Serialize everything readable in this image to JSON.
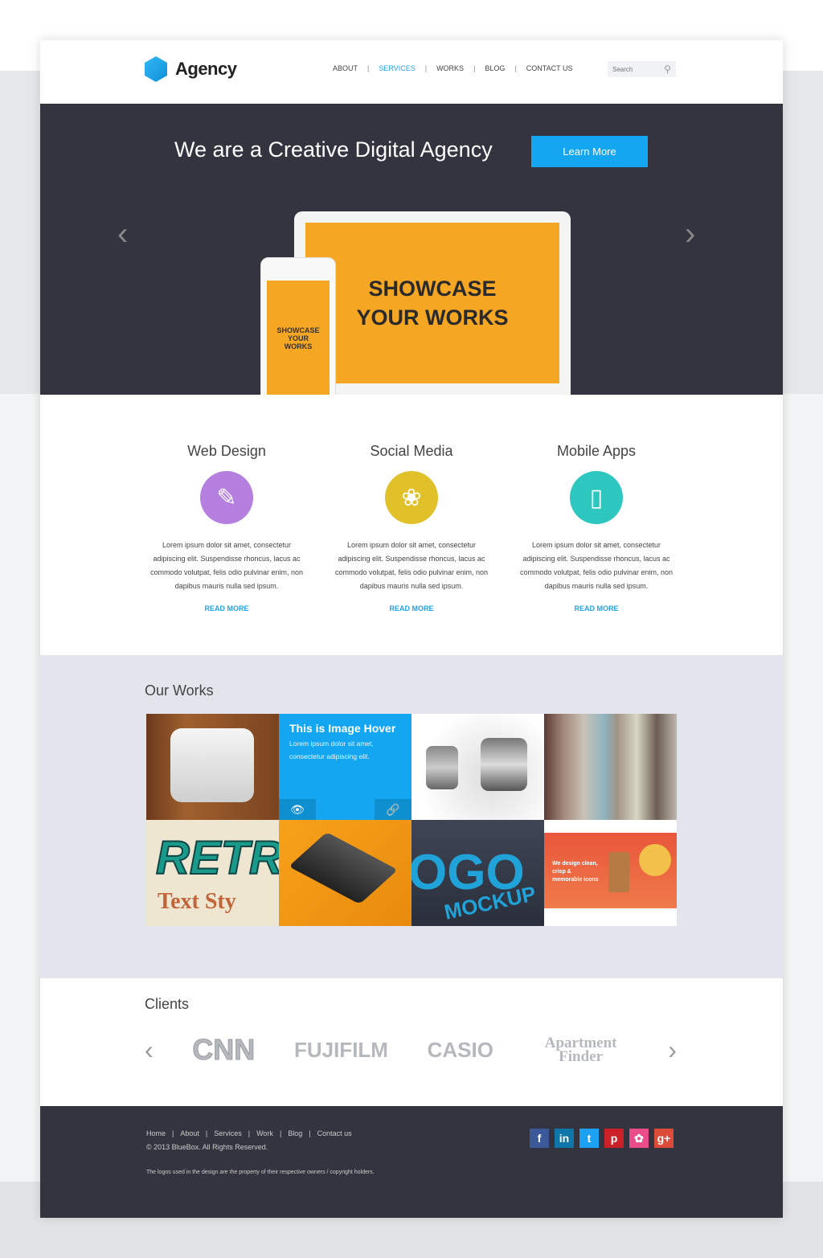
{
  "header": {
    "logo": "Agency",
    "nav": [
      "ABOUT",
      "SERVICES",
      "WORKS",
      "BLOG",
      "CONTACT US"
    ],
    "active_nav": "SERVICES",
    "search_placeholder": "Search"
  },
  "hero": {
    "title": "We are a Creative Digital Agency",
    "button": "Learn More",
    "laptop_text": "SHOWCASE YOUR WORKS",
    "phone_text": "SHOWCASE YOUR WORKS"
  },
  "services": [
    {
      "title": "Web Design",
      "icon": "paintbrush-icon",
      "color": "#b57fe0",
      "text": "Lorem ipsum dolor sit amet, consectetur adipiscing elit. Suspendisse rhoncus, lacus ac commodo volutpat, felis odio pulvinar enim, non dapibus mauris nulla sed ipsum.",
      "link": "READ MORE"
    },
    {
      "title": "Social Media",
      "icon": "share-icon",
      "color": "#e0c12a",
      "text": "Lorem ipsum dolor sit amet, consectetur adipiscing elit. Suspendisse rhoncus, lacus ac commodo volutpat, felis odio pulvinar enim, non dapibus mauris nulla sed ipsum.",
      "link": "READ MORE"
    },
    {
      "title": "Mobile Apps",
      "icon": "smartphone-icon",
      "color": "#2ec7c0",
      "text": "Lorem ipsum dolor sit amet, consectetur adipiscing elit. Suspendisse rhoncus, lacus ac commodo volutpat, felis odio pulvinar enim, non dapibus mauris nulla sed ipsum.",
      "link": "READ MORE"
    }
  ],
  "works": {
    "title": "Our Works",
    "hover_title": "This is Image Hover",
    "hover_text": "Lorem ipsum dolor sit amet, consectetur adipiscing elit.",
    "tile_retro": "RETR",
    "tile_retro_sub": "Text Sty",
    "tile_logo": "OGO",
    "tile_logo_sub": "MOCKUP",
    "tile_web": "We design clean, crisp & memorable icons"
  },
  "clients": {
    "title": "Clients",
    "logos": [
      "CNN",
      "FUJIFILM",
      "CASIO",
      "Apartment Finder"
    ]
  },
  "footer": {
    "links": [
      "Home",
      "About",
      "Services",
      "Work",
      "Blog",
      "Contact us"
    ],
    "copyright": "© 2013 BlueBox. All Rights Reserved.",
    "note": "The logos used in the design are the property of their respective owners / copyright holders.",
    "social": [
      {
        "label": "f",
        "name": "facebook",
        "color": "#3b5998"
      },
      {
        "label": "in",
        "name": "linkedin",
        "color": "#0e76a8"
      },
      {
        "label": "t",
        "name": "twitter",
        "color": "#1da1f2"
      },
      {
        "label": "p",
        "name": "pinterest",
        "color": "#cb2027"
      },
      {
        "label": "✿",
        "name": "dribbble",
        "color": "#ea4c89"
      },
      {
        "label": "g+",
        "name": "google-plus",
        "color": "#dd4b39"
      }
    ]
  }
}
